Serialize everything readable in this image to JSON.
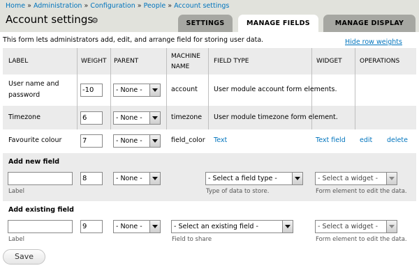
{
  "breadcrumb": {
    "items": [
      "Home",
      "Administration",
      "Configuration",
      "People",
      "Account settings"
    ],
    "separator": "»"
  },
  "page_title": "Account settings",
  "tabs": [
    {
      "label": "SETTINGS",
      "active": false
    },
    {
      "label": "MANAGE FIELDS",
      "active": true
    },
    {
      "label": "MANAGE DISPLAY",
      "active": false
    }
  ],
  "description": "This form lets administrators add, edit, and arrange field for storing user data.",
  "hide_weights_link": "Hide row weights",
  "table": {
    "headers": {
      "label": "LABEL",
      "weight": "WEIGHT",
      "parent": "PARENT",
      "machine_name_1": "MACHINE",
      "machine_name_2": "NAME",
      "field_type": "FIELD TYPE",
      "widget": "WIDGET",
      "operations": "OPERATIONS"
    },
    "rows": [
      {
        "label_1": "User name and",
        "label_2": "password",
        "weight": "-10",
        "parent": "- None -",
        "machine_name": "account",
        "field_type": "User module account form elements."
      },
      {
        "label": "Timezone",
        "weight": "6",
        "parent": "- None -",
        "machine_name": "timezone",
        "field_type": "User module timezone form element."
      },
      {
        "label": "Favourite colour",
        "weight": "7",
        "parent": "- None -",
        "machine_name": "field_color",
        "field_type": "Text",
        "widget": "Text field",
        "edit": "edit",
        "delete": "delete"
      }
    ],
    "add_new": {
      "title": "Add new field",
      "label_value": "",
      "label_help": "Label",
      "weight": "8",
      "parent": "- None -",
      "field_type_select": "- Select a field type -",
      "field_type_help": "Type of data to store.",
      "widget_select": "- Select a widget -",
      "widget_help": "Form element to edit the data."
    },
    "add_existing": {
      "title": "Add existing field",
      "label_value": "",
      "label_help": "Label",
      "weight": "9",
      "parent": "- None -",
      "existing_select": "- Select an existing field -",
      "existing_help": "Field to share",
      "widget_select": "- Select a widget -",
      "widget_help": "Form element to edit the data."
    }
  },
  "save_label": "Save",
  "colors": {
    "header_bg": "#e1e2dc",
    "tab_inactive": "#a6a7a2",
    "link": "#0074bd",
    "row_alt": "#ebebeb"
  }
}
